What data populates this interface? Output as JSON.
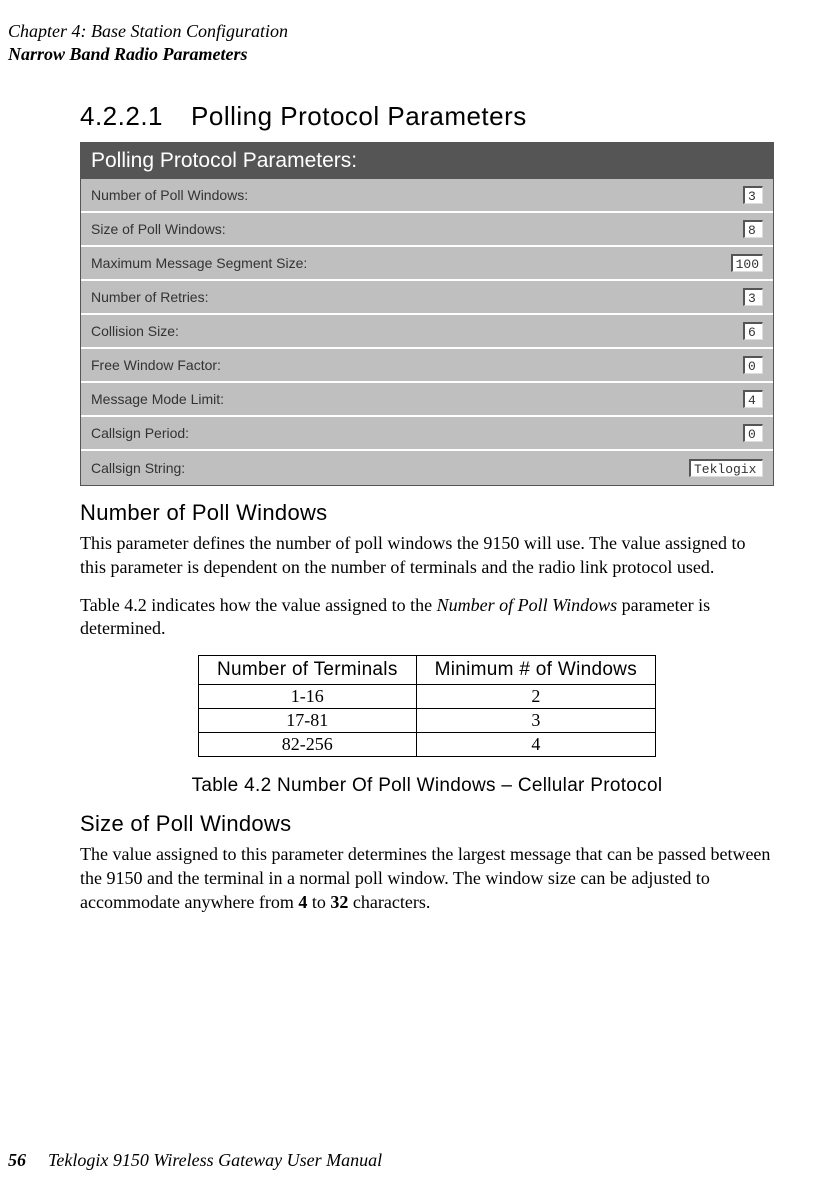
{
  "header": {
    "chapter": "Chapter 4:  Base Station Configuration",
    "section": "Narrow Band Radio Parameters"
  },
  "section_heading": {
    "number": "4.2.2.1",
    "title": "Polling Protocol Parameters"
  },
  "params_panel": {
    "title": "Polling Protocol Parameters:",
    "rows": {
      "num_poll_windows": {
        "label": "Number of Poll Windows:",
        "value": "3"
      },
      "size_poll_windows": {
        "label": "Size of Poll Windows:",
        "value": "8"
      },
      "max_msg_seg_size": {
        "label": "Maximum Message Segment Size:",
        "value": "100"
      },
      "num_retries": {
        "label": "Number of Retries:",
        "value": "3"
      },
      "collision_size": {
        "label": "Collision Size:",
        "value": "6"
      },
      "free_window_factor": {
        "label": "Free Window Factor:",
        "value": "0"
      },
      "message_mode_limit": {
        "label": "Message Mode Limit:",
        "value": "4"
      },
      "callsign_period": {
        "label": "Callsign Period:",
        "value": "0"
      },
      "callsign_string": {
        "label": "Callsign String:",
        "value": "Teklogix"
      }
    }
  },
  "subhead1": "Number of Poll Windows",
  "para1": "This parameter defines the number of poll windows the 9150 will use. The value assigned to this parameter is dependent on the number of terminals and the radio link protocol used.",
  "para2_pre": "Table 4.2 indicates how the value assigned to the ",
  "para2_em": "Number of Poll Windows",
  "para2_post": " parameter is determined.",
  "table42": {
    "head_terminals": "Number of Terminals",
    "head_windows": "Minimum # of Windows",
    "rows": {
      "r0": {
        "t": "1-16",
        "w": "2"
      },
      "r1": {
        "t": "17-81",
        "w": "3"
      },
      "r2": {
        "t": "82-256",
        "w": "4"
      }
    },
    "caption": "Table 4.2 Number Of Poll Windows – Cellular Protocol"
  },
  "subhead2": "Size of Poll Windows",
  "para3_pre": "The value assigned to this parameter determines the largest message that can be passed between the 9150 and the terminal in a normal poll window. The window size can be adjusted to accommodate anywhere from ",
  "para3_b1": "4",
  "para3_mid": " to ",
  "para3_b2": "32",
  "para3_post": " characters.",
  "footer": {
    "page": "56",
    "book": "Teklogix 9150 Wireless Gateway User Manual"
  }
}
